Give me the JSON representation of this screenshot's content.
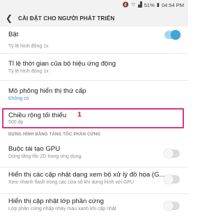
{
  "status_bar": {
    "icons": [
      "mute-icon",
      "wifi-icon",
      "signal-icon"
    ],
    "battery": "51%",
    "time": "04:54 PM"
  },
  "header": {
    "back_icon": "back-arrow-icon",
    "title": "CÀI ĐẶT CHO NGƯỜI PHÁT TRIỂN"
  },
  "master_switch": {
    "label": "Bật",
    "on": true
  },
  "partial_prev": {
    "sub": "Tỷ lệ hình động 1x"
  },
  "items": [
    {
      "title": "Tỉ lệ thời gian của bộ hiệu ứng động",
      "sub": "Tỷ lệ hình động 1x"
    },
    {
      "title": "Mô phỏng hiển thị thứ cấp",
      "sub": "Không có"
    },
    {
      "title": "Chiều rộng tối thiểu",
      "sub": "500 dp",
      "annotation": "1"
    }
  ],
  "section_hardware": {
    "header": "DỰNG HÌNH BẰNG TĂNG TỐC PHẦN CỨNG",
    "items": [
      {
        "title": "Buộc tái tạo GPU",
        "sub": "Dùng tăng tốc 2D trong ứng dụng.",
        "on": false
      },
      {
        "title": "Hiển thị các cập nhật dạng xem bộ xử lý đồ họa (G...",
        "sub": "Xem nhanh flash trong các cửa sổ khi dựng hình với GPU",
        "on": false
      },
      {
        "title": "Hiển thị cập nhật lớp phần cứng",
        "sub": "Lớp phần cứng nhấp nháy màu xanh khi cập nhật",
        "on": false
      }
    ]
  },
  "colors": {
    "accent": "#3ea6dd",
    "highlight": "#d33a7d",
    "annotation": "#d8232a"
  }
}
